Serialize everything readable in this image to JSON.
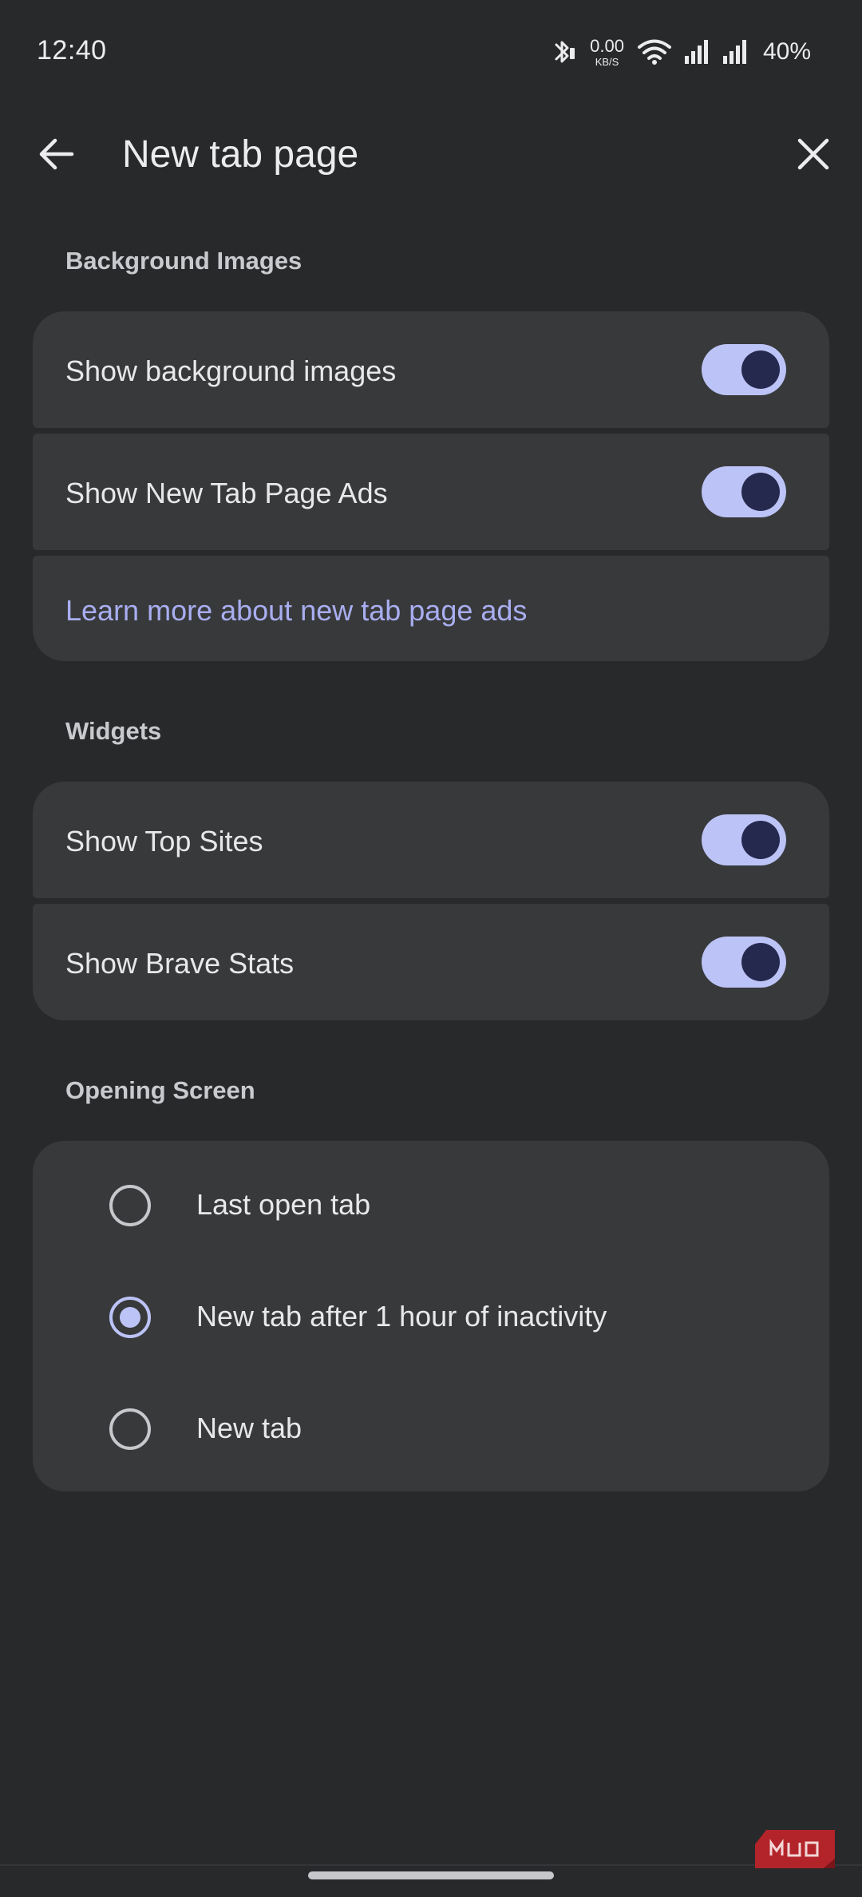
{
  "status_bar": {
    "time": "12:40",
    "net_speed_value": "0.00",
    "net_speed_unit": "KB/S",
    "battery": "40%",
    "icons": [
      "bluetooth-icon",
      "wifi-icon",
      "signal-icon",
      "signal-icon"
    ]
  },
  "app_bar": {
    "title": "New tab page",
    "back_icon": "arrow-left-icon",
    "close_icon": "close-icon"
  },
  "sections": {
    "background_images": {
      "header": "Background Images",
      "show_background_images": {
        "label": "Show background images",
        "enabled": true
      },
      "show_ntp_ads": {
        "label": "Show New Tab Page Ads",
        "enabled": true
      },
      "learn_more": "Learn more about new tab page ads"
    },
    "widgets": {
      "header": "Widgets",
      "show_top_sites": {
        "label": "Show Top Sites",
        "enabled": true
      },
      "show_brave_stats": {
        "label": "Show Brave Stats",
        "enabled": true
      }
    },
    "opening_screen": {
      "header": "Opening Screen",
      "options": [
        {
          "label": "Last open tab",
          "selected": false
        },
        {
          "label": "New tab after 1 hour of inactivity",
          "selected": true
        },
        {
          "label": "New tab",
          "selected": false
        }
      ]
    }
  },
  "watermark": "MUO",
  "colors": {
    "background": "#28292b",
    "card": "#38393b",
    "accent": "#bcc3f6",
    "knob": "#26294e",
    "link": "#a9aef0",
    "watermark": "#b3242a"
  }
}
